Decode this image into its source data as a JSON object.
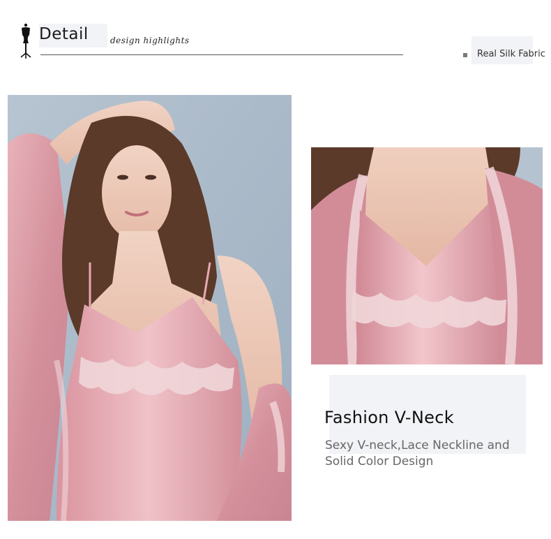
{
  "header": {
    "title": "Detail",
    "subtitle": "design highlights",
    "tag": "Real Silk Fabric"
  },
  "icons": {
    "header_icon": "mannequin-icon",
    "tag_marker": "square-bullet-icon"
  },
  "feature": {
    "title": "Fashion V-Neck",
    "description": "Sexy V-neck,Lace Neckline and Solid Color Design"
  },
  "colors": {
    "silk_pink": "#d99aa3",
    "background_blue": "#a9b9c8",
    "lace": "#f0d6d8",
    "accent_panel": "#f2f3f6"
  }
}
